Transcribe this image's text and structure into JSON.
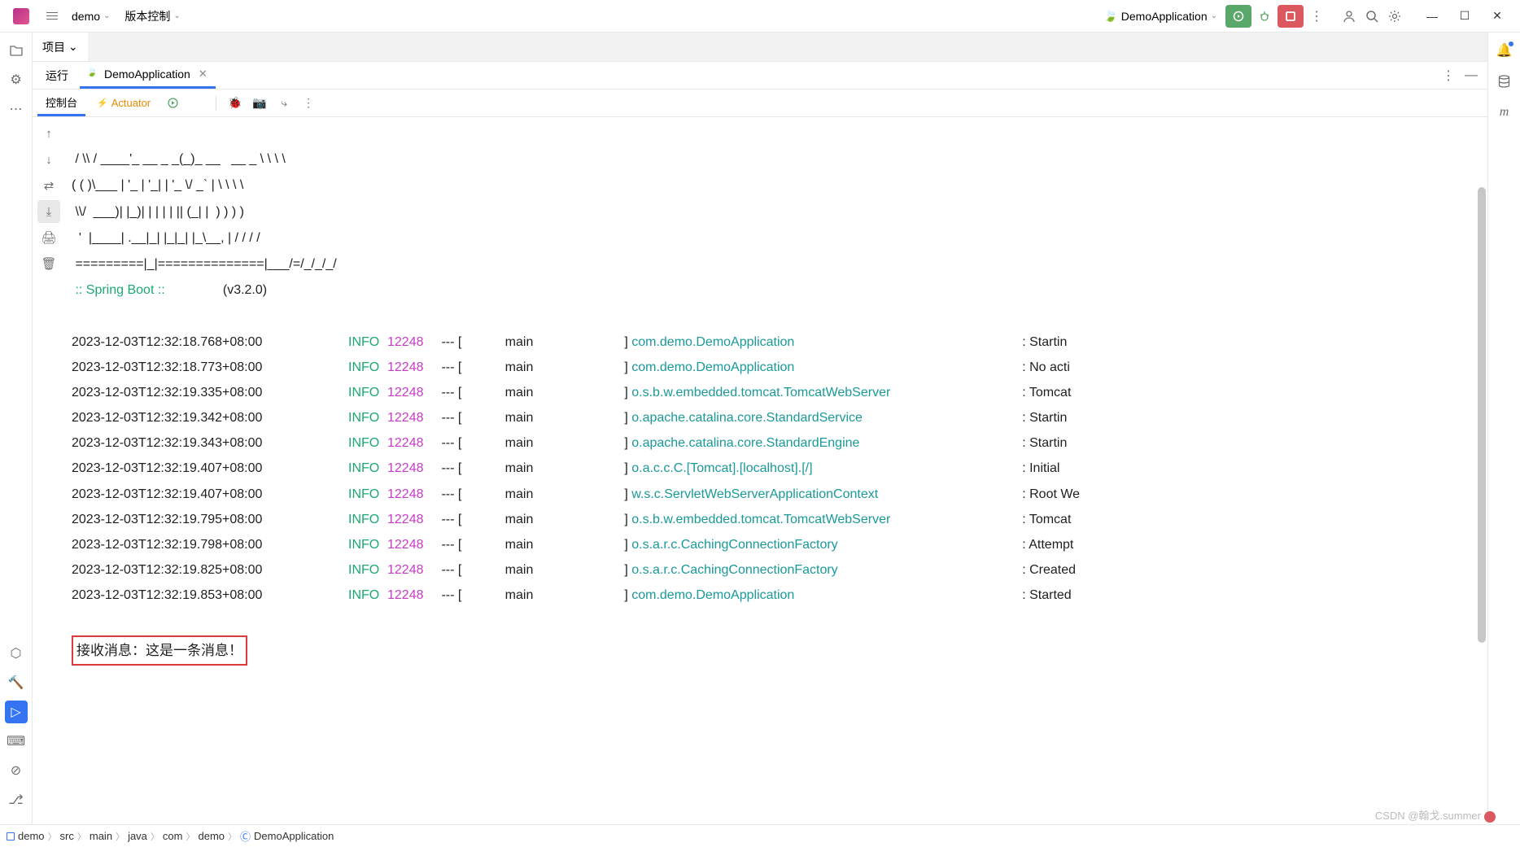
{
  "titlebar": {
    "project": "demo",
    "vcs": "版本控制",
    "runConfig": "DemoApplication"
  },
  "projectPanel": {
    "title": "项目"
  },
  "toolWindow": {
    "label": "运行",
    "appTab": "DemoApplication",
    "toolbar": {
      "consoleTab": "控制台",
      "actuatorTab": "Actuator"
    }
  },
  "console": {
    "ascii": [
      " / \\\\ / ____'_ __ _ _(_)_ __   __ _ \\ \\ \\ \\",
      "( ( )\\___ | '_ | '_| | '_ \\/ _` | \\ \\ \\ \\",
      " \\\\/  ___)| |_)| | | | | || (_| |  ) ) ) )",
      "  '  |____| .__|_| |_|_| |_\\__, | / / / /",
      " =========|_|==============|___/=/_/_/_/"
    ],
    "springBoot": " :: Spring Boot ::",
    "springVersion": "(v3.2.0)",
    "pid": "12248",
    "level": "INFO",
    "thread": "main",
    "logs": [
      {
        "ts": "2023-12-03T12:32:18.768+08:00",
        "logger": "com.demo.DemoApplication",
        "msg": ": Startin"
      },
      {
        "ts": "2023-12-03T12:32:18.773+08:00",
        "logger": "com.demo.DemoApplication",
        "msg": ": No acti"
      },
      {
        "ts": "2023-12-03T12:32:19.335+08:00",
        "logger": "o.s.b.w.embedded.tomcat.TomcatWebServer",
        "msg": ": Tomcat "
      },
      {
        "ts": "2023-12-03T12:32:19.342+08:00",
        "logger": "o.apache.catalina.core.StandardService",
        "msg": ": Startin"
      },
      {
        "ts": "2023-12-03T12:32:19.343+08:00",
        "logger": "o.apache.catalina.core.StandardEngine",
        "msg": ": Startin"
      },
      {
        "ts": "2023-12-03T12:32:19.407+08:00",
        "logger": "o.a.c.c.C.[Tomcat].[localhost].[/]",
        "msg": ": Initial"
      },
      {
        "ts": "2023-12-03T12:32:19.407+08:00",
        "logger": "w.s.c.ServletWebServerApplicationContext",
        "msg": ": Root We"
      },
      {
        "ts": "2023-12-03T12:32:19.795+08:00",
        "logger": "o.s.b.w.embedded.tomcat.TomcatWebServer",
        "msg": ": Tomcat "
      },
      {
        "ts": "2023-12-03T12:32:19.798+08:00",
        "logger": "o.s.a.r.c.CachingConnectionFactory",
        "msg": ": Attempt"
      },
      {
        "ts": "2023-12-03T12:32:19.825+08:00",
        "logger": "o.s.a.r.c.CachingConnectionFactory",
        "msg": ": Created"
      },
      {
        "ts": "2023-12-03T12:32:19.853+08:00",
        "logger": "com.demo.DemoApplication",
        "msg": ": Started"
      }
    ],
    "highlighted": "接收消息：这是一条消息！"
  },
  "breadcrumb": {
    "items": [
      "demo",
      "src",
      "main",
      "java",
      "com",
      "demo",
      "DemoApplication"
    ]
  },
  "watermark": "CSDN @翰戈.summer"
}
